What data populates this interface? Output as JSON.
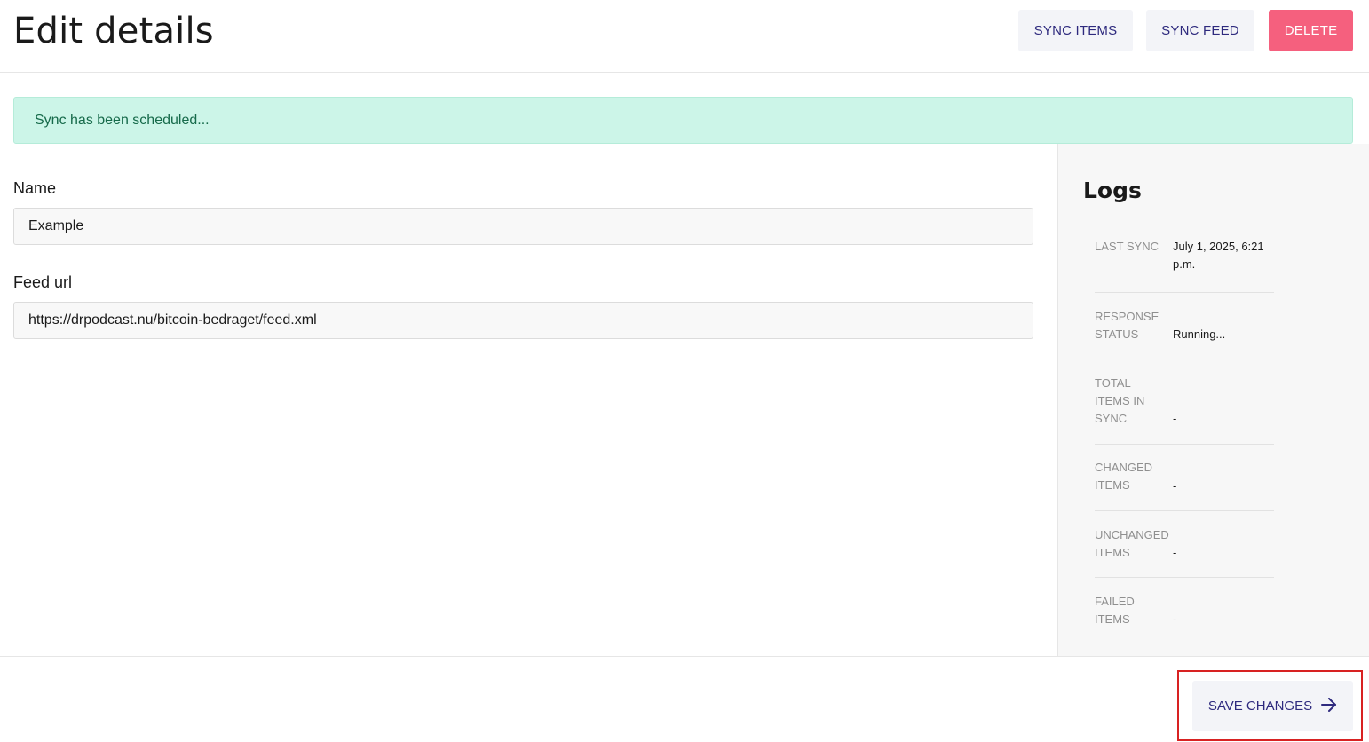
{
  "header": {
    "title": "Edit details",
    "buttons": {
      "sync_items": "SYNC ITEMS",
      "sync_feed": "SYNC FEED",
      "delete": "DELETE"
    }
  },
  "alert": {
    "message": "Sync has been scheduled..."
  },
  "form": {
    "name_label": "Name",
    "name_value": "Example",
    "feed_label": "Feed url",
    "feed_value": "https://drpodcast.nu/bitcoin-bedraget/feed.xml"
  },
  "logs": {
    "title": "Logs",
    "rows": [
      {
        "key": "LAST SYNC",
        "value": "July 1, 2025, 6:21 p.m."
      },
      {
        "key": "RESPONSE STATUS",
        "value": "Running..."
      },
      {
        "key": "TOTAL ITEMS IN SYNC",
        "value": "-"
      },
      {
        "key": "CHANGED ITEMS",
        "value": "-"
      },
      {
        "key": "UNCHANGED ITEMS",
        "value": "-"
      },
      {
        "key": "FAILED ITEMS",
        "value": "-"
      }
    ]
  },
  "footer": {
    "save_label": "SAVE CHANGES",
    "save_icon": "arrow-right-icon"
  },
  "colors": {
    "accent_text": "#2e2a7e",
    "delete_bg": "#f5607e",
    "alert_bg": "#ccf5e8",
    "alert_text": "#166a4a",
    "highlight": "#d82222"
  }
}
